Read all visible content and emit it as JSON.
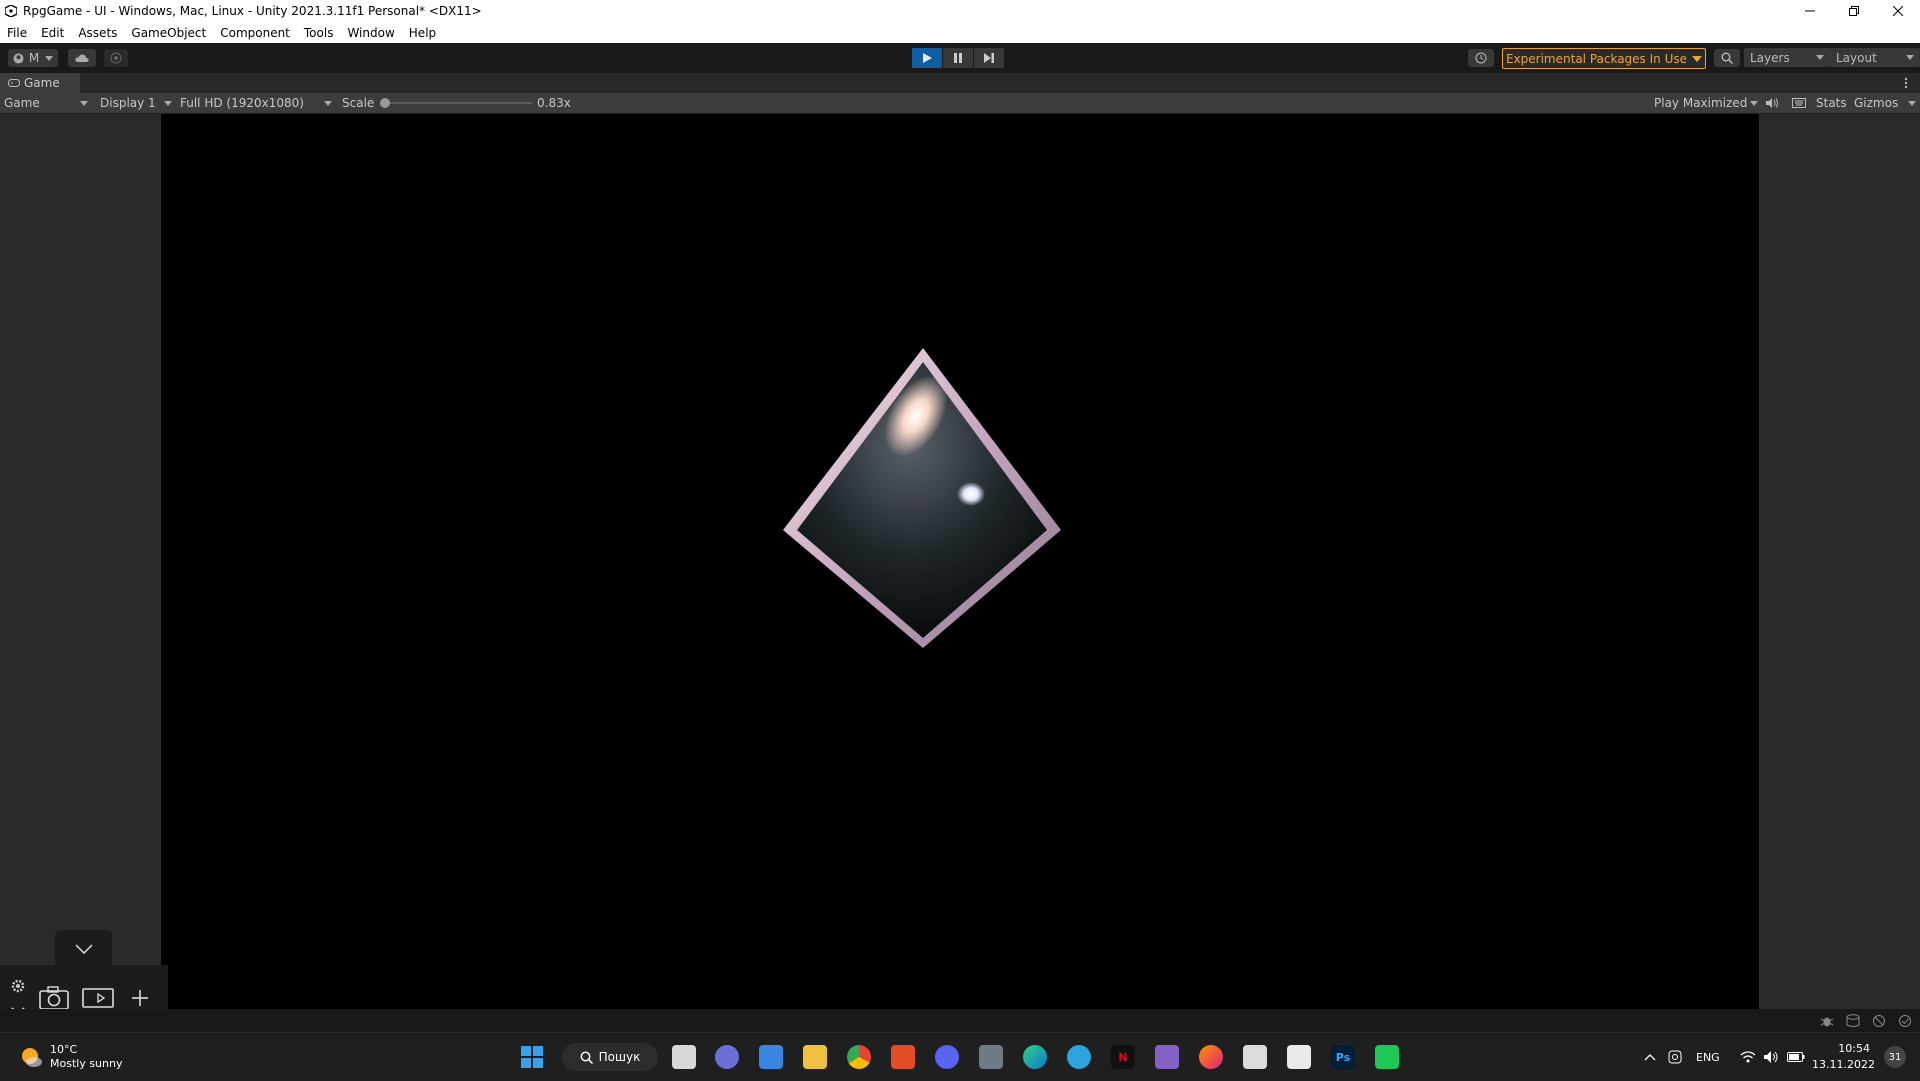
{
  "window": {
    "title": "RpgGame - UI - Windows, Mac, Linux - Unity 2021.3.11f1 Personal* <DX11>"
  },
  "menu": [
    "File",
    "Edit",
    "Assets",
    "GameObject",
    "Component",
    "Tools",
    "Window",
    "Help"
  ],
  "toolbar": {
    "account_label": "M",
    "experimental_label": "Experimental Packages In Use",
    "layers_label": "Layers",
    "layout_label": "Layout"
  },
  "tab": {
    "label": "Game"
  },
  "game_toolbar": {
    "view_label": "Game",
    "display_label": "Display 1",
    "resolution_label": "Full HD (1920x1080)",
    "scale_label": "Scale",
    "scale_value": "0.83x",
    "play_mode_label": "Play Maximized",
    "stats_label": "Stats",
    "gizmos_label": "Gizmos"
  },
  "weather": {
    "temp": "10°C",
    "desc": "Mostly sunny"
  },
  "taskbar": {
    "search_label": "Пошук",
    "language": "ENG",
    "time": "10:54",
    "date": "13.11.2022",
    "notification_count": "31"
  },
  "colors": {
    "accent_play": "#0f5fa0",
    "experimental": "#f0a43a"
  }
}
